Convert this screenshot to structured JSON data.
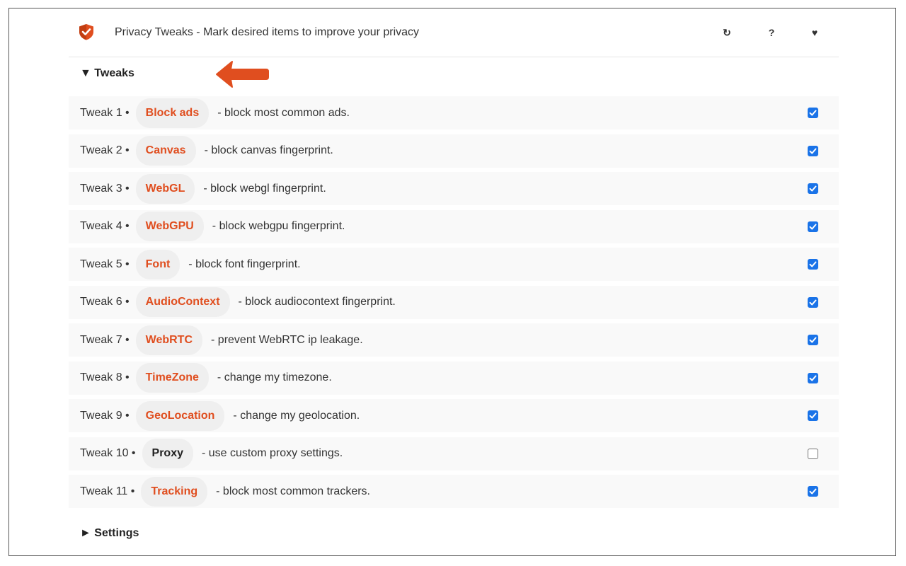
{
  "header": {
    "title": "Privacy Tweaks - Mark desired items to improve your privacy",
    "logo_icon": "shield-check-icon",
    "reload_icon": "reload-icon",
    "reload_glyph": "↻",
    "help_icon": "help-icon",
    "help_glyph": "?",
    "heart_icon": "heart-icon",
    "heart_glyph": "♥"
  },
  "sections": {
    "tweaks_label": "▼ Tweaks",
    "settings_label": "► Settings"
  },
  "colors": {
    "accent": "#e04e1f",
    "checkbox": "#1a73e8",
    "row_bg": "#f9f9f9",
    "pill_bg": "#efefef"
  },
  "tweaks": [
    {
      "num": "Tweak 1 •",
      "name": "Block ads",
      "desc": "- block most common ads.",
      "checked": true
    },
    {
      "num": "Tweak 2 •",
      "name": "Canvas",
      "desc": "- block canvas fingerprint.",
      "checked": true
    },
    {
      "num": "Tweak 3 •",
      "name": "WebGL",
      "desc": "- block webgl fingerprint.",
      "checked": true
    },
    {
      "num": "Tweak 4 •",
      "name": "WebGPU",
      "desc": "- block webgpu fingerprint.",
      "checked": true
    },
    {
      "num": "Tweak 5 •",
      "name": "Font",
      "desc": "- block font fingerprint.",
      "checked": true
    },
    {
      "num": "Tweak 6 •",
      "name": "AudioContext",
      "desc": "- block audiocontext fingerprint.",
      "checked": true
    },
    {
      "num": "Tweak 7 •",
      "name": "WebRTC",
      "desc": "- prevent WebRTC ip leakage.",
      "checked": true
    },
    {
      "num": "Tweak 8 •",
      "name": "TimeZone",
      "desc": "- change my timezone.",
      "checked": true
    },
    {
      "num": "Tweak 9 •",
      "name": "GeoLocation",
      "desc": "- change my geolocation.",
      "checked": true
    },
    {
      "num": "Tweak 10 •",
      "name": "Proxy",
      "desc": "- use custom proxy settings.",
      "checked": false
    },
    {
      "num": "Tweak 11 •",
      "name": "Tracking",
      "desc": "- block most common trackers.",
      "checked": true
    }
  ]
}
